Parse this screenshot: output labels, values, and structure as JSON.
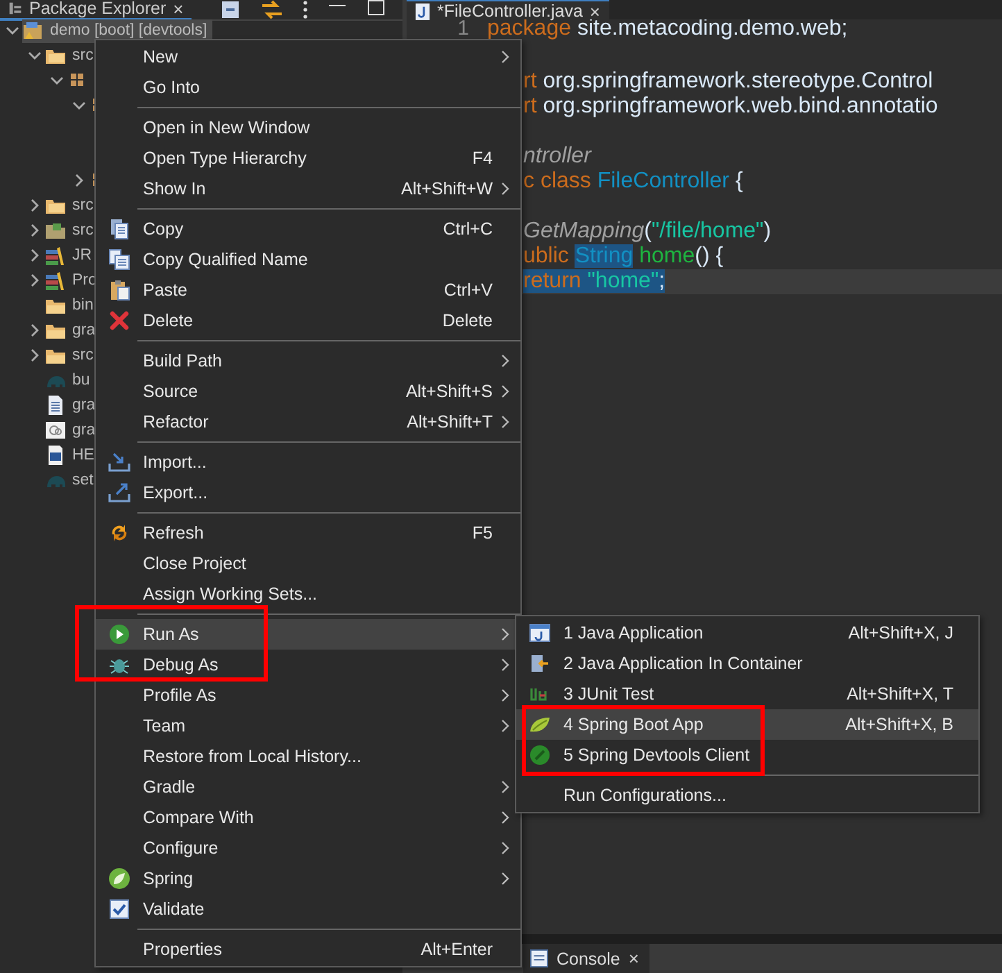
{
  "explorer": {
    "tab": {
      "title": "Package Explorer",
      "close": "×",
      "selected": true
    },
    "tree": [
      {
        "label": "demo [boot] [devtools]",
        "kind": "project",
        "expanded": true,
        "selected": true,
        "children": [
          {
            "label": "src",
            "kind": "source-folder",
            "expanded": true,
            "children": [
              {
                "kind": "package",
                "expanded": true,
                "children": [
                  {
                    "kind": "package",
                    "expanded": true
                  },
                  {
                    "kind": "package",
                    "expanded": false
                  }
                ]
              }
            ]
          },
          {
            "label": "src",
            "kind": "source-folder",
            "expanded": false
          },
          {
            "label": "src",
            "kind": "resource-folder",
            "expanded": false
          },
          {
            "label": "JR",
            "kind": "library",
            "expanded": false
          },
          {
            "label": "Pro",
            "kind": "library",
            "expanded": false
          },
          {
            "label": "bin",
            "kind": "folder"
          },
          {
            "label": "gra",
            "kind": "folder",
            "expanded": false
          },
          {
            "label": "src",
            "kind": "folder",
            "expanded": false
          },
          {
            "label": "bu",
            "kind": "gradle"
          },
          {
            "label": "gra",
            "kind": "text-file"
          },
          {
            "label": "gra",
            "kind": "image-file"
          },
          {
            "label": "HE",
            "kind": "word-file"
          },
          {
            "label": "set",
            "kind": "gradle"
          }
        ]
      }
    ]
  },
  "editor": {
    "tab": {
      "title": "*FileController.java",
      "close": "×",
      "selected": true
    },
    "lines": [
      {
        "number": "1",
        "current": false,
        "tokens": [
          {
            "text": "package",
            "kind": "keyword",
            "selected": false
          },
          {
            "text": " site.metacoding.demo.web;",
            "kind": "plain",
            "selected": false
          }
        ]
      },
      {
        "current": false
      },
      {
        "current": false,
        "tokens": [
          {
            "text": "rt",
            "kind": "keyword",
            "selected": false
          },
          {
            "text": " org.springframework.stereotype.Control",
            "kind": "plain",
            "selected": false
          }
        ]
      },
      {
        "current": false,
        "tokens": [
          {
            "text": "rt",
            "kind": "keyword",
            "selected": false
          },
          {
            "text": " org.springframework.web.bind.annotatio",
            "kind": "plain",
            "selected": false
          }
        ]
      },
      {
        "current": false
      },
      {
        "current": false,
        "tokens": [
          {
            "text": "ntroller",
            "kind": "annotation",
            "selected": false
          }
        ]
      },
      {
        "current": false,
        "tokens": [
          {
            "text": "c class",
            "kind": "keyword",
            "selected": false
          },
          {
            "text": " FileController",
            "kind": "type",
            "selected": false
          },
          {
            "text": " {",
            "kind": "plain",
            "selected": false
          }
        ]
      },
      {
        "current": false
      },
      {
        "current": false,
        "tokens": [
          {
            "text": "GetMapping",
            "kind": "annotation",
            "selected": false
          },
          {
            "text": "(",
            "kind": "plain",
            "selected": false
          },
          {
            "text": "\"/file/home\"",
            "kind": "string",
            "selected": false
          },
          {
            "text": ")",
            "kind": "plain",
            "selected": false
          }
        ]
      },
      {
        "current": false,
        "tokens": [
          {
            "text": "ublic ",
            "kind": "keyword",
            "selected": false
          },
          {
            "text": "String",
            "kind": "type",
            "selected": true
          },
          {
            "text": " home",
            "kind": "method",
            "selected": false
          },
          {
            "text": "() {",
            "kind": "plain",
            "selected": false
          }
        ]
      },
      {
        "current": true,
        "tokens": [
          {
            "text": "return ",
            "kind": "keyword",
            "selected": true
          },
          {
            "text": "\"home\"",
            "kind": "string",
            "selected": true
          },
          {
            "text": ";",
            "kind": "plain",
            "selected": true
          }
        ]
      }
    ]
  },
  "bottom_panel": {
    "tabs": [
      {
        "title": "Console",
        "close": "×",
        "selected": true
      }
    ]
  },
  "context_menu": {
    "items": [
      {
        "kind": "item",
        "label": "New",
        "submenu": true,
        "selected": false
      },
      {
        "kind": "item",
        "label": "Go Into",
        "selected": false
      },
      {
        "kind": "separator"
      },
      {
        "kind": "item",
        "label": "Open in New Window",
        "selected": false
      },
      {
        "kind": "item",
        "label": "Open Type Hierarchy",
        "shortcut": "F4",
        "selected": false
      },
      {
        "kind": "item",
        "label": "Show In",
        "shortcut": "Alt+Shift+W",
        "submenu": true,
        "selected": false
      },
      {
        "kind": "separator"
      },
      {
        "kind": "item",
        "label": "Copy",
        "shortcut": "Ctrl+C",
        "selected": false
      },
      {
        "kind": "item",
        "label": "Copy Qualified Name",
        "selected": false
      },
      {
        "kind": "item",
        "label": "Paste",
        "shortcut": "Ctrl+V",
        "selected": false
      },
      {
        "kind": "item",
        "label": "Delete",
        "shortcut": "Delete",
        "selected": false
      },
      {
        "kind": "separator"
      },
      {
        "kind": "item",
        "label": "Build Path",
        "submenu": true,
        "selected": false
      },
      {
        "kind": "item",
        "label": "Source",
        "shortcut": "Alt+Shift+S",
        "submenu": true,
        "selected": false
      },
      {
        "kind": "item",
        "label": "Refactor",
        "shortcut": "Alt+Shift+T",
        "submenu": true,
        "selected": false
      },
      {
        "kind": "separator"
      },
      {
        "kind": "item",
        "label": "Import...",
        "selected": false
      },
      {
        "kind": "item",
        "label": "Export...",
        "selected": false
      },
      {
        "kind": "separator"
      },
      {
        "kind": "item",
        "label": "Refresh",
        "shortcut": "F5",
        "selected": false
      },
      {
        "kind": "item",
        "label": "Close Project",
        "selected": false
      },
      {
        "kind": "item",
        "label": "Assign Working Sets...",
        "selected": false
      },
      {
        "kind": "separator"
      },
      {
        "kind": "item",
        "label": "Run As",
        "submenu": true,
        "selected": true
      },
      {
        "kind": "item",
        "label": "Debug As",
        "submenu": true,
        "selected": false
      },
      {
        "kind": "item",
        "label": "Profile As",
        "submenu": true,
        "selected": false
      },
      {
        "kind": "item",
        "label": "Team",
        "submenu": true,
        "selected": false
      },
      {
        "kind": "item",
        "label": "Restore from Local History...",
        "selected": false
      },
      {
        "kind": "item",
        "label": "Gradle",
        "submenu": true,
        "selected": false
      },
      {
        "kind": "item",
        "label": "Compare With",
        "submenu": true,
        "selected": false
      },
      {
        "kind": "item",
        "label": "Configure",
        "submenu": true,
        "selected": false
      },
      {
        "kind": "item",
        "label": "Spring",
        "submenu": true,
        "selected": false
      },
      {
        "kind": "item",
        "label": "Validate",
        "selected": false
      },
      {
        "kind": "separator"
      },
      {
        "kind": "item",
        "label": "Properties",
        "shortcut": "Alt+Enter",
        "selected": false
      }
    ]
  },
  "run_as_submenu": {
    "items": [
      {
        "kind": "item",
        "label": "1 Java Application",
        "shortcut": "Alt+Shift+X, J",
        "selected": false
      },
      {
        "kind": "item",
        "label": "2 Java Application In Container",
        "selected": false
      },
      {
        "kind": "item",
        "label": "3 JUnit Test",
        "shortcut": "Alt+Shift+X, T",
        "selected": false
      },
      {
        "kind": "item",
        "label": "4 Spring Boot App",
        "shortcut": "Alt+Shift+X, B",
        "selected": true
      },
      {
        "kind": "item",
        "label": "5 Spring Devtools Client",
        "selected": false
      },
      {
        "kind": "separator"
      },
      {
        "kind": "item",
        "label": "Run Configurations...",
        "selected": false
      }
    ]
  }
}
